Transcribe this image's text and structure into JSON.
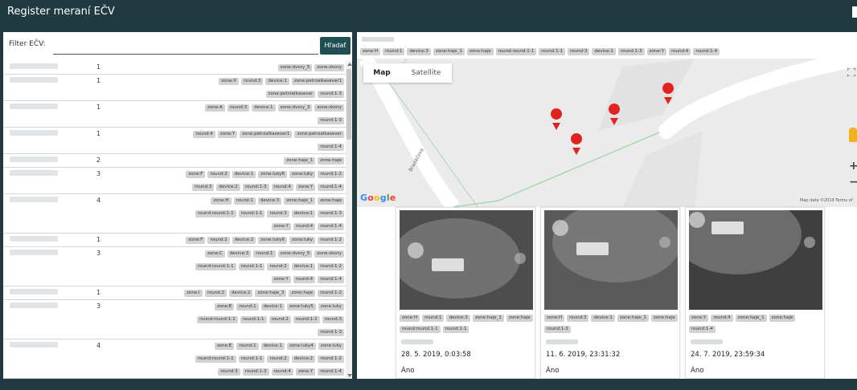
{
  "app": {
    "title": "Register meraní EČV"
  },
  "filter": {
    "label": "Filter EČV:",
    "value": "",
    "search_label": "Hľadať"
  },
  "rows": [
    {
      "count": "1",
      "tag_lines": [
        [
          "zone:dvory_5",
          "zone:dvory"
        ]
      ]
    },
    {
      "count": "1",
      "tag_lines": [
        [
          "zone:X",
          "round:3",
          "device:1",
          "zone:petrzalkasever1"
        ],
        [
          "zone:petrzalkasever",
          "round:1-3"
        ]
      ]
    },
    {
      "count": "1",
      "tag_lines": [
        [
          "zone:A",
          "round:3",
          "device:1",
          "zone:dvory_3",
          "zone:dvory"
        ],
        [
          "round:1-3"
        ]
      ]
    },
    {
      "count": "1",
      "tag_lines": [
        [
          "round:4",
          "zone:Y",
          "zone:petrzalkasever1",
          "zone:petrzalkasever"
        ],
        [
          "round:1-4"
        ]
      ]
    },
    {
      "count": "2",
      "tag_lines": [
        [
          "zone:haje_1",
          "zone:haje"
        ]
      ]
    },
    {
      "count": "3",
      "tag_lines": [
        [
          "zone:F",
          "round:2",
          "device:1",
          "zone:luky6",
          "zone:luky",
          "round:1-2"
        ],
        [
          "round:3",
          "device:2",
          "round:1-3",
          "round:4",
          "zone:Y",
          "round:1-4"
        ]
      ]
    },
    {
      "count": "4",
      "tag_lines": [
        [
          "zone:H",
          "round:1",
          "device:3",
          "zone:haje_1",
          "zone:haje"
        ],
        [
          "round:round:1-1",
          "round:1-1",
          "round:3",
          "device:1",
          "round:1-3"
        ],
        [
          "zone:Y",
          "round:4",
          "round:1-4"
        ]
      ]
    },
    {
      "count": "1",
      "tag_lines": [
        [
          "zone:F",
          "round:2",
          "device:2",
          "zone:luky6",
          "zone:luky",
          "round:1-2"
        ]
      ]
    },
    {
      "count": "3",
      "tag_lines": [
        [
          "zone:C",
          "device:3",
          "round:1",
          "zone:dvory_5",
          "zone:dvory"
        ],
        [
          "round:round:1-1",
          "round:1-1",
          "round:2",
          "device:1",
          "round:1-2"
        ],
        [
          "zone:Y",
          "round:4",
          "round:1-4"
        ]
      ]
    },
    {
      "count": "1",
      "tag_lines": [
        [
          "zone:I",
          "round:2",
          "device:2",
          "zone:haje_3",
          "zone:haje",
          "round:1-2"
        ]
      ]
    },
    {
      "count": "3",
      "tag_lines": [
        [
          "zone:E",
          "round:1",
          "device:1",
          "zone:luky5",
          "zone:luky"
        ],
        [
          "round:round:1-1",
          "round:1-1",
          "round:2",
          "round:1-2",
          "round:3"
        ],
        [
          "round:1-3"
        ]
      ]
    },
    {
      "count": "4",
      "tag_lines": [
        [
          "zone:E",
          "round:1",
          "device:1",
          "zone:luky4",
          "zone:luky"
        ],
        [
          "round:round:1-1",
          "round:1-1",
          "round:2",
          "device:2",
          "round:1-2"
        ],
        [
          "round:3",
          "round:1-3",
          "round:4",
          "zone:Y",
          "round:1-4"
        ]
      ]
    }
  ],
  "detail": {
    "tags": [
      "zone:H",
      "round:1",
      "device:3",
      "zone:haje_1",
      "zone:haje",
      "round:round:1-1",
      "round:1-1",
      "round:3",
      "device:1",
      "round:1-3",
      "zone:Y",
      "round:4",
      "round:1-4"
    ],
    "map": {
      "tab_map": "Map",
      "tab_satellite": "Satellite",
      "google_logo": "Google",
      "attribution": "Map data ©2019   Terms of",
      "street": "Bradáčova"
    },
    "cards": [
      {
        "tag_lines": [
          [
            "zone:H",
            "round:1",
            "device:3",
            "zone:haje_1",
            "zone:haje"
          ],
          [
            "round:round:1-1",
            "round:1-1"
          ]
        ],
        "date": "28. 5. 2019, 0:03:58",
        "status": "Áno"
      },
      {
        "tag_lines": [
          [
            "zone:H",
            "round:3",
            "device:1",
            "zone:haje_1",
            "zone:haje"
          ],
          [
            "round:1-3"
          ]
        ],
        "date": "11. 6. 2019, 23:31:32",
        "status": "Áno"
      },
      {
        "tag_lines": [
          [
            "zone:Y",
            "round:4",
            "zone:haje_1",
            "zone:haje"
          ],
          [
            "round:1-4"
          ]
        ],
        "date": "24. 7. 2019, 23:59:34",
        "status": "Áno"
      }
    ]
  },
  "colors": {
    "header": "#1f3b3f",
    "button": "#1f4f52",
    "tag": "#d2d2d2",
    "pin": "#e0231c"
  }
}
